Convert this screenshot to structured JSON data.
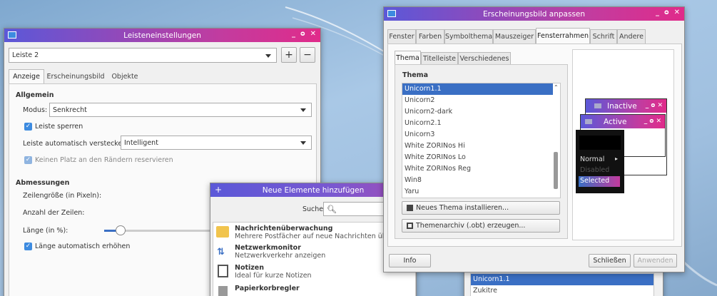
{
  "panel_window": {
    "title": "Leisteneinstellungen",
    "panel_select": "Leiste 2",
    "add_label": "+",
    "remove_label": "−",
    "tabs": [
      "Anzeige",
      "Erscheinungsbild",
      "Objekte"
    ],
    "general_heading": "Allgemein",
    "mode_label": "Modus:",
    "mode_value": "Senkrecht",
    "lock_label": "Leiste sperren",
    "autohide_label": "Leiste automatisch verstecken:",
    "autohide_value": "Intelligent",
    "no_reserve_label": "Keinen Platz an den Rändern reservieren",
    "dimensions_heading": "Abmessungen",
    "row_size_label": "Zeilengröße (in Pixeln):",
    "rows_label": "Anzahl der Zeilen:",
    "length_label": "Länge (in %):",
    "auto_length_label": "Länge automatisch erhöhen"
  },
  "add_window": {
    "title": "Neue Elemente hinzufügen",
    "search_label": "Suche:",
    "items": [
      {
        "name": "Nachrichtenüberwachung",
        "desc": "Mehrere Postfächer auf neue Nachrichten überprüfen"
      },
      {
        "name": "Netzwerkmonitor",
        "desc": "Netzwerkverkehr anzeigen"
      },
      {
        "name": "Notizen",
        "desc": "Ideal für kurze Notizen"
      },
      {
        "name": "Papierkorbregler",
        "desc": ""
      }
    ]
  },
  "appearance_window": {
    "title": "Erscheinungsbild anpassen",
    "tabs": [
      "Fenster",
      "Farben",
      "Symbolthema",
      "Mauszeiger",
      "Fensterrahmen",
      "Schrift",
      "Andere"
    ],
    "subtabs": [
      "Thema",
      "Titelleiste",
      "Verschiedenes"
    ],
    "theme_heading": "Thema",
    "themes": [
      "Unicorn1.1",
      "Unicorn2",
      "Unicorn2-dark",
      "Unicorn2.1",
      "Unicorn3",
      "White ZORINos Hi",
      "White ZORINos Lo",
      "White ZORINos Reg",
      "Win8",
      "Yaru"
    ],
    "install_button": "Neues Thema installieren...",
    "archive_button": "Themenarchiv (.obt) erzeugen...",
    "info_button": "Info",
    "close_button": "Schließen",
    "apply_button": "Anwenden",
    "preview": {
      "inactive": "Inactive",
      "active": "Active",
      "menu_normal": "Normal",
      "menu_disabled": "Disabled",
      "menu_selected": "Selected"
    }
  },
  "behind_list": {
    "items": [
      "Unicorn1.1",
      "Zukitre"
    ]
  },
  "colors": {
    "accent": "#3a6fc4",
    "title_start": "#5b58d8",
    "title_end": "#e02b8a"
  }
}
